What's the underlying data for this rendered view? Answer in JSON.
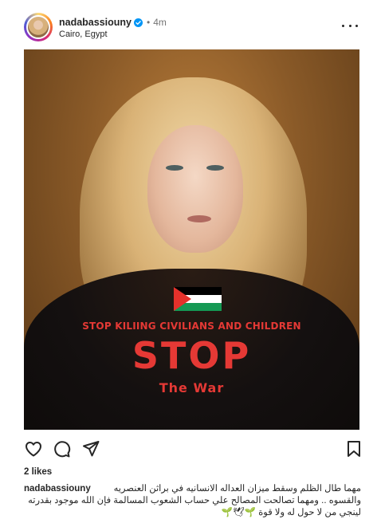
{
  "header": {
    "username": "nadabassiouny",
    "separator": "•",
    "time": "4m",
    "location": "Cairo, Egypt"
  },
  "media": {
    "slogan_small": "STOP KILIING CIVILIANS AND CHILDREN",
    "slogan_big": "STOP",
    "slogan_war": "The War",
    "flag_colors": [
      "#000000",
      "#ffffff",
      "#149954",
      "#e4312b"
    ]
  },
  "actions": {
    "icons": [
      "heart-icon",
      "comment-icon",
      "share-icon",
      "bookmark-icon"
    ]
  },
  "likes": "2 likes",
  "caption": {
    "username": "nadabassiouny",
    "text": "مهما طال الظلم وسقط ميزان العداله الانسانيه في براثن العنصريه والقسوه .. ومهما تصالحت المصالح علي حساب الشعوب المسالمة فإن الله موجود بقدرته لينجي من لا حول له ولا قوة 🌱🕊🌱"
  },
  "colors": {
    "text": "#262626",
    "muted": "#737373",
    "verified": "#0095f6",
    "slogan": "#e53935"
  }
}
